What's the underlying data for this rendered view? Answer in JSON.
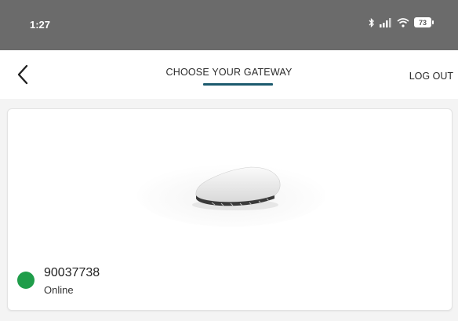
{
  "status_bar": {
    "time": "1:27",
    "battery": "73",
    "icons": [
      "bluetooth-icon",
      "signal-icon",
      "wifi-icon",
      "battery-icon"
    ]
  },
  "header": {
    "back_icon": "chevron-left-icon",
    "title": "CHOOSE YOUR GATEWAY",
    "logout_label": "LOG OUT",
    "accent_color": "#1c5a6e"
  },
  "gateway": {
    "id": "90037738",
    "status": "Online",
    "status_color": "#1f9d4a"
  }
}
